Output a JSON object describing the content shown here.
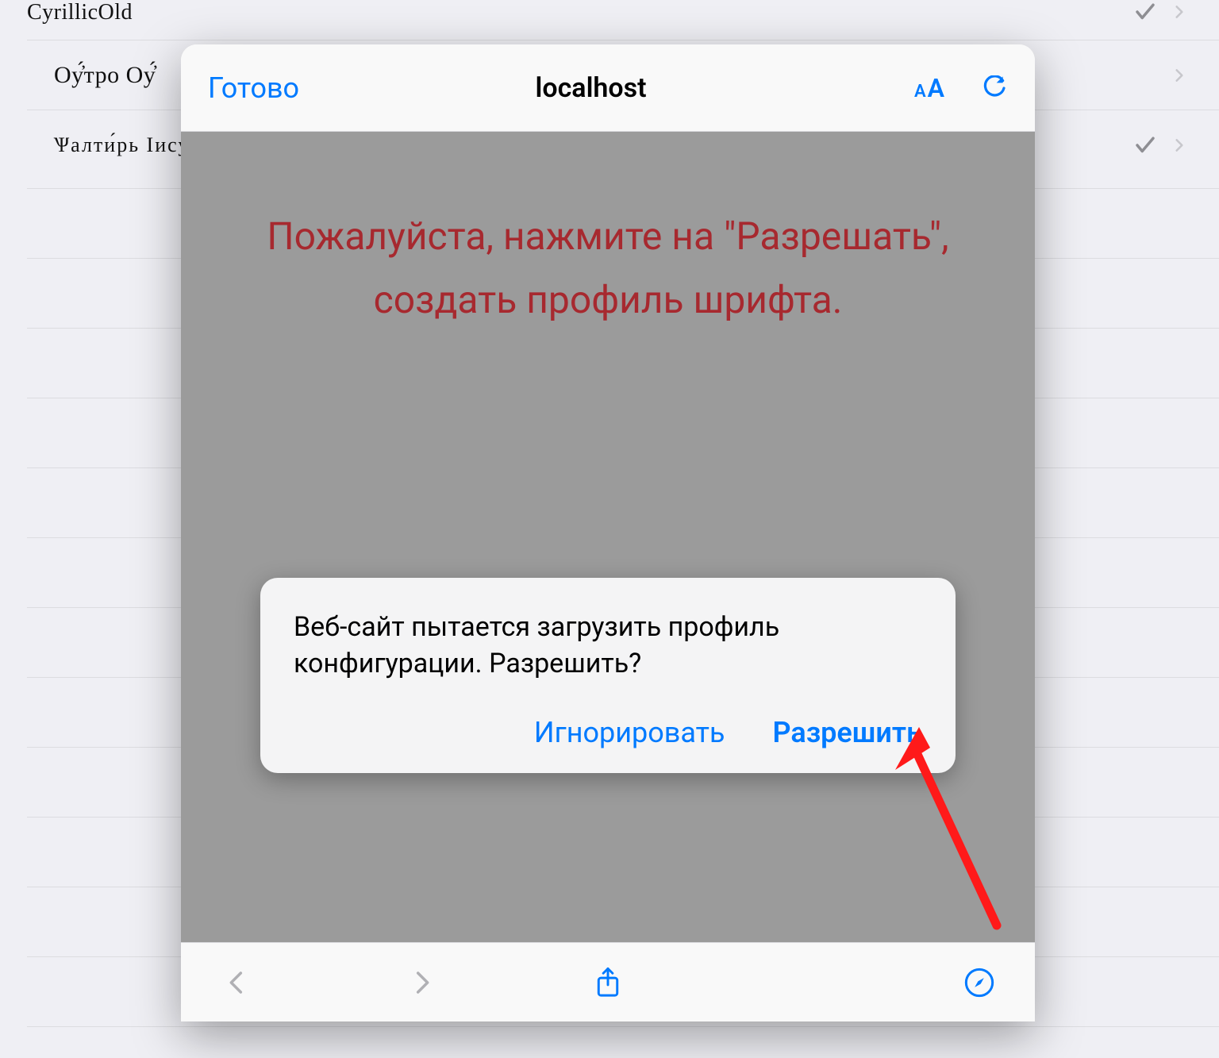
{
  "background_list": {
    "rows": [
      {
        "label": "CyrillicOld"
      },
      {
        "label": "Оу҆́тро Оу҆́"
      },
      {
        "label": "Ѱалти́рь Іису́съ"
      }
    ]
  },
  "webview": {
    "done_label": "Готово",
    "title": "localhost",
    "message_line1": "Пожалуйста, нажмите на \"Разрешать\",",
    "message_line2": "создать профиль шрифта."
  },
  "alert": {
    "text": "Веб-сайт пытается загрузить профиль конфигурации. Разрешить?",
    "ignore_label": "Игнорировать",
    "allow_label": "Разрешить"
  },
  "colors": {
    "ios_blue": "#007aff",
    "message_red": "#a7292f"
  }
}
